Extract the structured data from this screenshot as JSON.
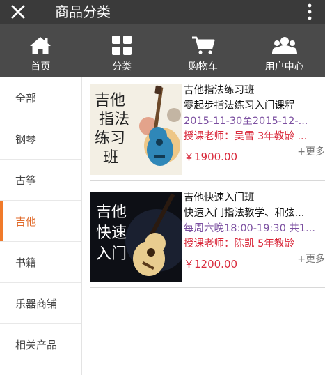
{
  "header": {
    "title": "商品分类"
  },
  "nav": [
    {
      "label": "首页",
      "icon": "home-icon"
    },
    {
      "label": "分类",
      "icon": "grid-icon"
    },
    {
      "label": "购物车",
      "icon": "cart-icon"
    },
    {
      "label": "用户中心",
      "icon": "users-icon"
    }
  ],
  "categories": [
    "全部",
    "钢琴",
    "古筝",
    "吉他",
    "书籍",
    "乐器商铺",
    "相关产品"
  ],
  "active_category": "吉他",
  "products": [
    {
      "thumb_text": [
        "吉他",
        "指法",
        "练习",
        "班"
      ],
      "title": "吉他指法练习班",
      "subtitle": "零起步指法练习入门课程",
      "time": "2015-11-30至2015-12-...",
      "teacher": "授课老师：吴雪 3年教龄 ...",
      "price": "￥1900.00",
      "more": "+更多"
    },
    {
      "thumb_text": [
        "吉他",
        "快速",
        "入门"
      ],
      "title": "吉他快速入门班",
      "subtitle": "快速入门指法教学、和弦...",
      "time": "每周六晚18:00-19:30 共1...",
      "teacher": "授课老师：陈凯 5年教龄",
      "price": "￥1200.00",
      "more": "+更多"
    }
  ],
  "colors": {
    "titlebar": "#3a3a3a",
    "navbar": "#4a4a4a",
    "accent": "#f07a2a",
    "price": "#d9293b",
    "time": "#7b4fa0"
  }
}
